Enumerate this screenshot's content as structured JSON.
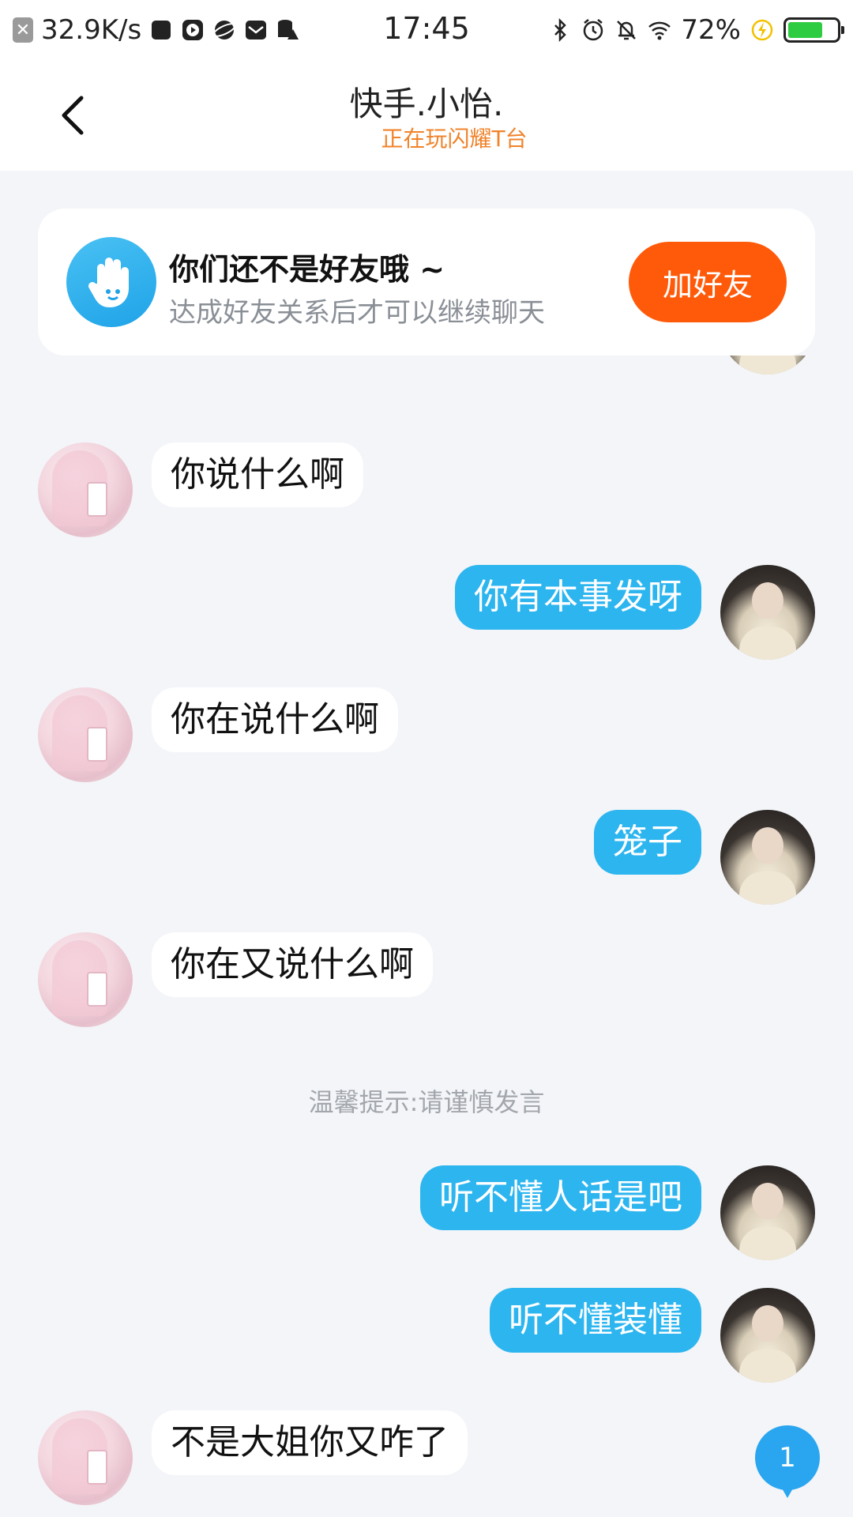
{
  "status_bar": {
    "speed": "32.9K/s",
    "time": "17:45",
    "battery": "72%"
  },
  "nav": {
    "title": "快手.小怡.",
    "subtitle": "正在玩闪耀T台"
  },
  "friend_card": {
    "title": "你们还不是好友哦 ~",
    "desc": "达成好友关系后才可以继续聊天",
    "button": "加好友"
  },
  "messages": [
    {
      "from": "other",
      "text": "你说什么啊"
    },
    {
      "from": "self",
      "text": "你有本事发呀"
    },
    {
      "from": "other",
      "text": "你在说什么啊"
    },
    {
      "from": "self",
      "text": "笼子"
    },
    {
      "from": "other",
      "text": "你在又说什么啊"
    },
    {
      "from": "self",
      "text": "听不懂人话是吧"
    },
    {
      "from": "self",
      "text": "听不懂装懂"
    },
    {
      "from": "other",
      "text": "不是大姐你又咋了"
    }
  ],
  "tip": "温馨提示:请谨慎发言",
  "unread_count": "1",
  "colors": {
    "accent_blue": "#2db5ef",
    "accent_orange": "#ff5a0a",
    "subtitle_orange": "#f0832b"
  }
}
